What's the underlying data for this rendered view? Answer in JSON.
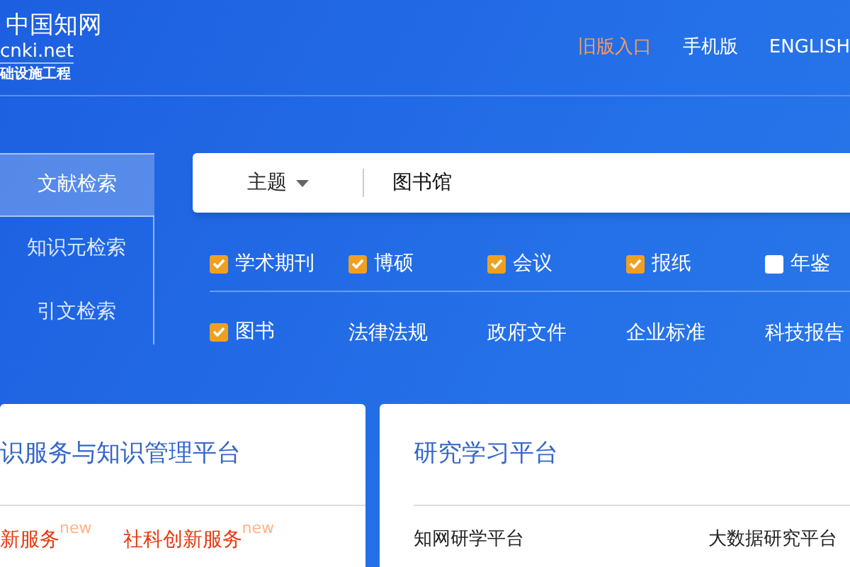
{
  "logo": {
    "name": "中国知网",
    "domain": "cnki.net",
    "slogan": "础设施工程"
  },
  "nav": [
    {
      "label": "旧版入口",
      "highlighted": true
    },
    {
      "label": "手机版",
      "highlighted": false
    },
    {
      "label": "ENGLISH",
      "highlighted": false
    }
  ],
  "search_tabs": [
    {
      "label": "文献检索",
      "selected": true
    },
    {
      "label": "知识元检索",
      "selected": false
    },
    {
      "label": "引文检索",
      "selected": false
    }
  ],
  "search": {
    "field": "主题",
    "value": "图书馆"
  },
  "resource_rows": [
    [
      {
        "kind": "checkbox",
        "label": "学术期刊",
        "checked": true
      },
      {
        "kind": "checkbox",
        "label": "博硕",
        "checked": true
      },
      {
        "kind": "checkbox",
        "label": "会议",
        "checked": true
      },
      {
        "kind": "checkbox",
        "label": "报纸",
        "checked": true
      },
      {
        "kind": "checkbox",
        "label": "年鉴",
        "checked": false
      }
    ],
    [
      {
        "kind": "checkbox",
        "label": "图书",
        "checked": true
      },
      {
        "kind": "link",
        "label": "法律法规"
      },
      {
        "kind": "link",
        "label": "政府文件"
      },
      {
        "kind": "link",
        "label": "企业标准"
      },
      {
        "kind": "link",
        "label": "科技报告"
      }
    ]
  ],
  "cards": [
    {
      "title": "识服务与知识管理平台",
      "links": [
        {
          "label": "新服务",
          "badge": "new",
          "kind": "service"
        },
        {
          "label": "社科创新服务",
          "badge": "new",
          "kind": "service"
        }
      ]
    },
    {
      "title": "研究学习平台",
      "links": [
        {
          "label": "知网研学平台",
          "kind": "plain"
        },
        {
          "label": "大数据研究平台",
          "kind": "plain"
        }
      ]
    }
  ]
}
